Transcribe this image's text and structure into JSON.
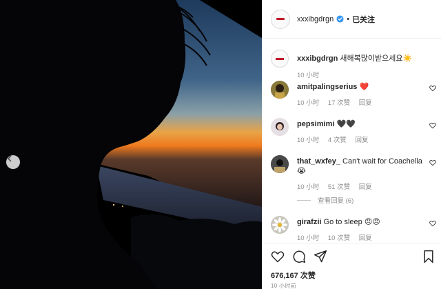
{
  "post": {
    "author": "xxxibgdrgn",
    "follow_separator": "•",
    "follow_label": "已关注",
    "caption": "새해복많이받으세요☀️",
    "caption_time": "10 小时",
    "likes": "676,167 次赞",
    "posted_time": "10 小时前"
  },
  "comments": [
    {
      "user": "amitpalingserius",
      "text": "❤️",
      "time": "10 小时",
      "likes": "17 次赞",
      "reply": "回复"
    },
    {
      "user": "pepsimimi",
      "text": "🖤🖤",
      "time": "10 小时",
      "likes": "4 次赞",
      "reply": "回复"
    },
    {
      "user": "that_wxfey_",
      "text": "Can't wait for Coachella 😭",
      "time": "10 小时",
      "likes": "51 次赞",
      "reply": "回复"
    },
    {
      "user": "girafzii",
      "text": "Go to sleep 😠😠",
      "time": "10 小时",
      "likes": "10 次赞",
      "reply": "回复"
    }
  ],
  "view_replies": "查看回复 (6)",
  "colors": {
    "accent": "#0095f6",
    "verified": "#3897f0",
    "text": "#262626",
    "muted": "#8e8e8e",
    "heart": "#ed4956"
  }
}
